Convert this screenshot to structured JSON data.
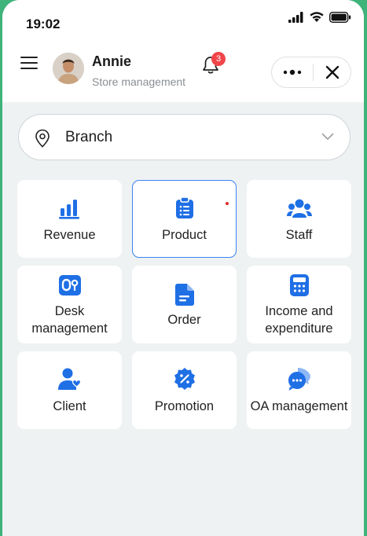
{
  "status_bar": {
    "time": "19:02"
  },
  "header": {
    "user_name": "Annie",
    "user_role": "Store management",
    "notification_count": "3",
    "more_icon": "more-dots-icon",
    "close_icon": "close-icon"
  },
  "branch_selector": {
    "label": "Branch",
    "icon": "location-pin-icon"
  },
  "tiles": [
    {
      "label": "Revenue",
      "icon": "bar-chart-icon"
    },
    {
      "label": "Product",
      "icon": "clipboard-list-icon",
      "selected": true
    },
    {
      "label": "Staff",
      "icon": "team-icon"
    },
    {
      "label": "Desk\nmanagement",
      "icon": "desk-icon"
    },
    {
      "label": "Order",
      "icon": "document-icon"
    },
    {
      "label": "Income and\nexpenditure",
      "icon": "calculator-icon"
    },
    {
      "label": "Client",
      "icon": "client-heart-icon"
    },
    {
      "label": "Promotion",
      "icon": "discount-badge-icon"
    },
    {
      "label": "OA management",
      "icon": "chat-bubbles-icon"
    }
  ],
  "colors": {
    "accent": "#1f6fe5",
    "badge": "#f0454a",
    "frame": "#3eb37a"
  }
}
